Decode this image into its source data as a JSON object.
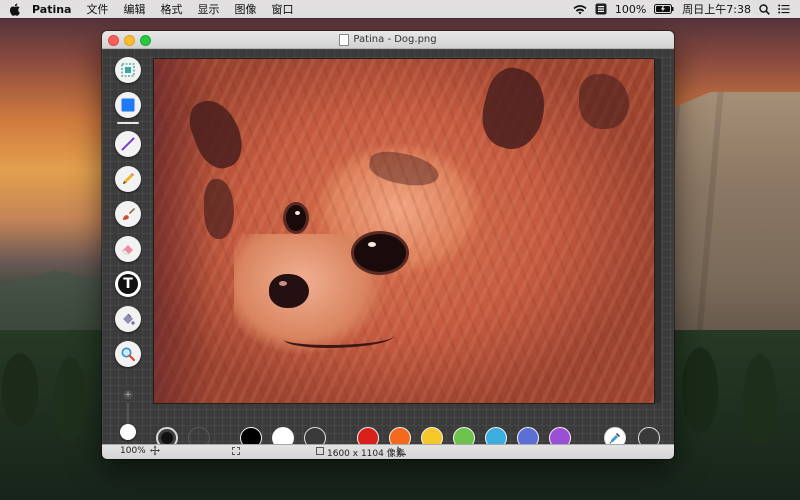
{
  "menubar": {
    "app_name": "Patina",
    "menus": [
      "文件",
      "编辑",
      "格式",
      "显示",
      "图像",
      "窗口"
    ],
    "battery": "100%",
    "clock": "周日上午7:38"
  },
  "window": {
    "title": "Patina - Dog.png"
  },
  "tools": [
    {
      "name": "select",
      "icon": "selection-icon"
    },
    {
      "name": "shape",
      "icon": "square-shape-icon"
    },
    {
      "name": "line",
      "icon": "line-icon"
    },
    {
      "name": "pencil",
      "icon": "pencil-icon"
    },
    {
      "name": "brush",
      "icon": "brush-icon"
    },
    {
      "name": "eraser",
      "icon": "eraser-icon"
    },
    {
      "name": "text",
      "icon": "text-icon",
      "glyph": "T"
    },
    {
      "name": "fill",
      "icon": "paint-bucket-icon"
    },
    {
      "name": "zoom",
      "icon": "magnifier-icon"
    }
  ],
  "size_slider": {
    "plus": "+",
    "minus": "−"
  },
  "palette": {
    "stroke_color": "#111111",
    "colors": [
      "#000000",
      "#ffffff",
      "#3a3a3a",
      "#d9211c",
      "#f36a1f",
      "#f4c72a",
      "#6cc24a",
      "#3aaee0",
      "#5b6fd6",
      "#9b4fd6"
    ]
  },
  "status": {
    "zoom": "100%",
    "dimensions": "1600 x 1104 像素"
  },
  "colors": {
    "accent_blue": "#1e7bf2",
    "menubar_bg": "#ececec"
  }
}
